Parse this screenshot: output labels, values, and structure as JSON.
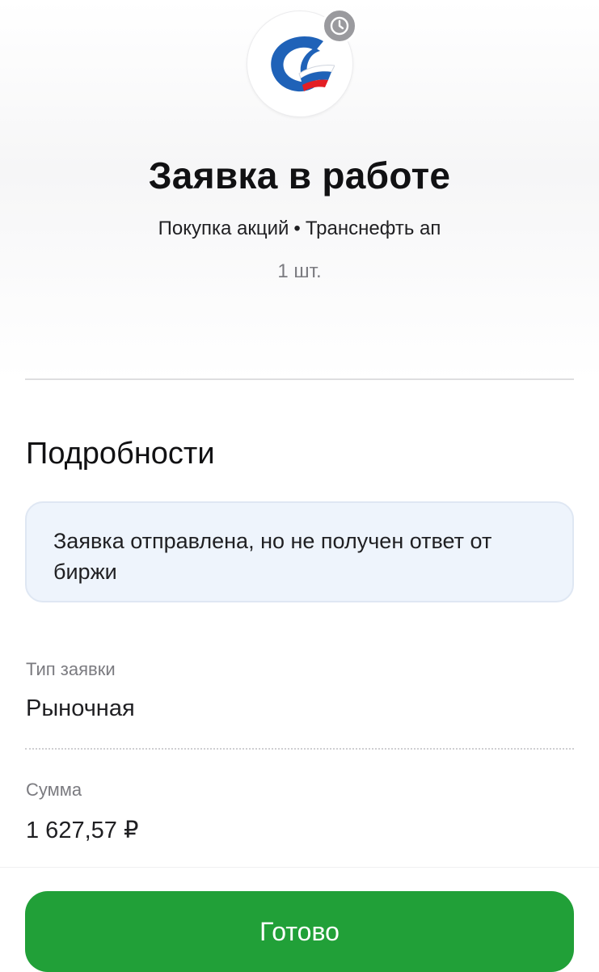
{
  "header": {
    "logo_icon": "transneft-logo-icon",
    "status_icon": "clock-icon",
    "title": "Заявка в работе",
    "subtitle_operation": "Покупка акций",
    "subtitle_separator": "•",
    "subtitle_instrument": "Транснефть ап",
    "quantity": "1 шт."
  },
  "details": {
    "section_title": "Подробности",
    "notice": "Заявка отправлена, но не получен ответ от биржи",
    "fields": [
      {
        "label": "Тип заявки",
        "value": "Рыночная"
      },
      {
        "label": "Сумма",
        "value": "1 627,57 ₽"
      }
    ]
  },
  "footer": {
    "done_label": "Готово"
  },
  "colors": {
    "accent_green": "#21a038",
    "notice_bg": "#eef4fc",
    "badge_gray": "#9a9a9e"
  }
}
